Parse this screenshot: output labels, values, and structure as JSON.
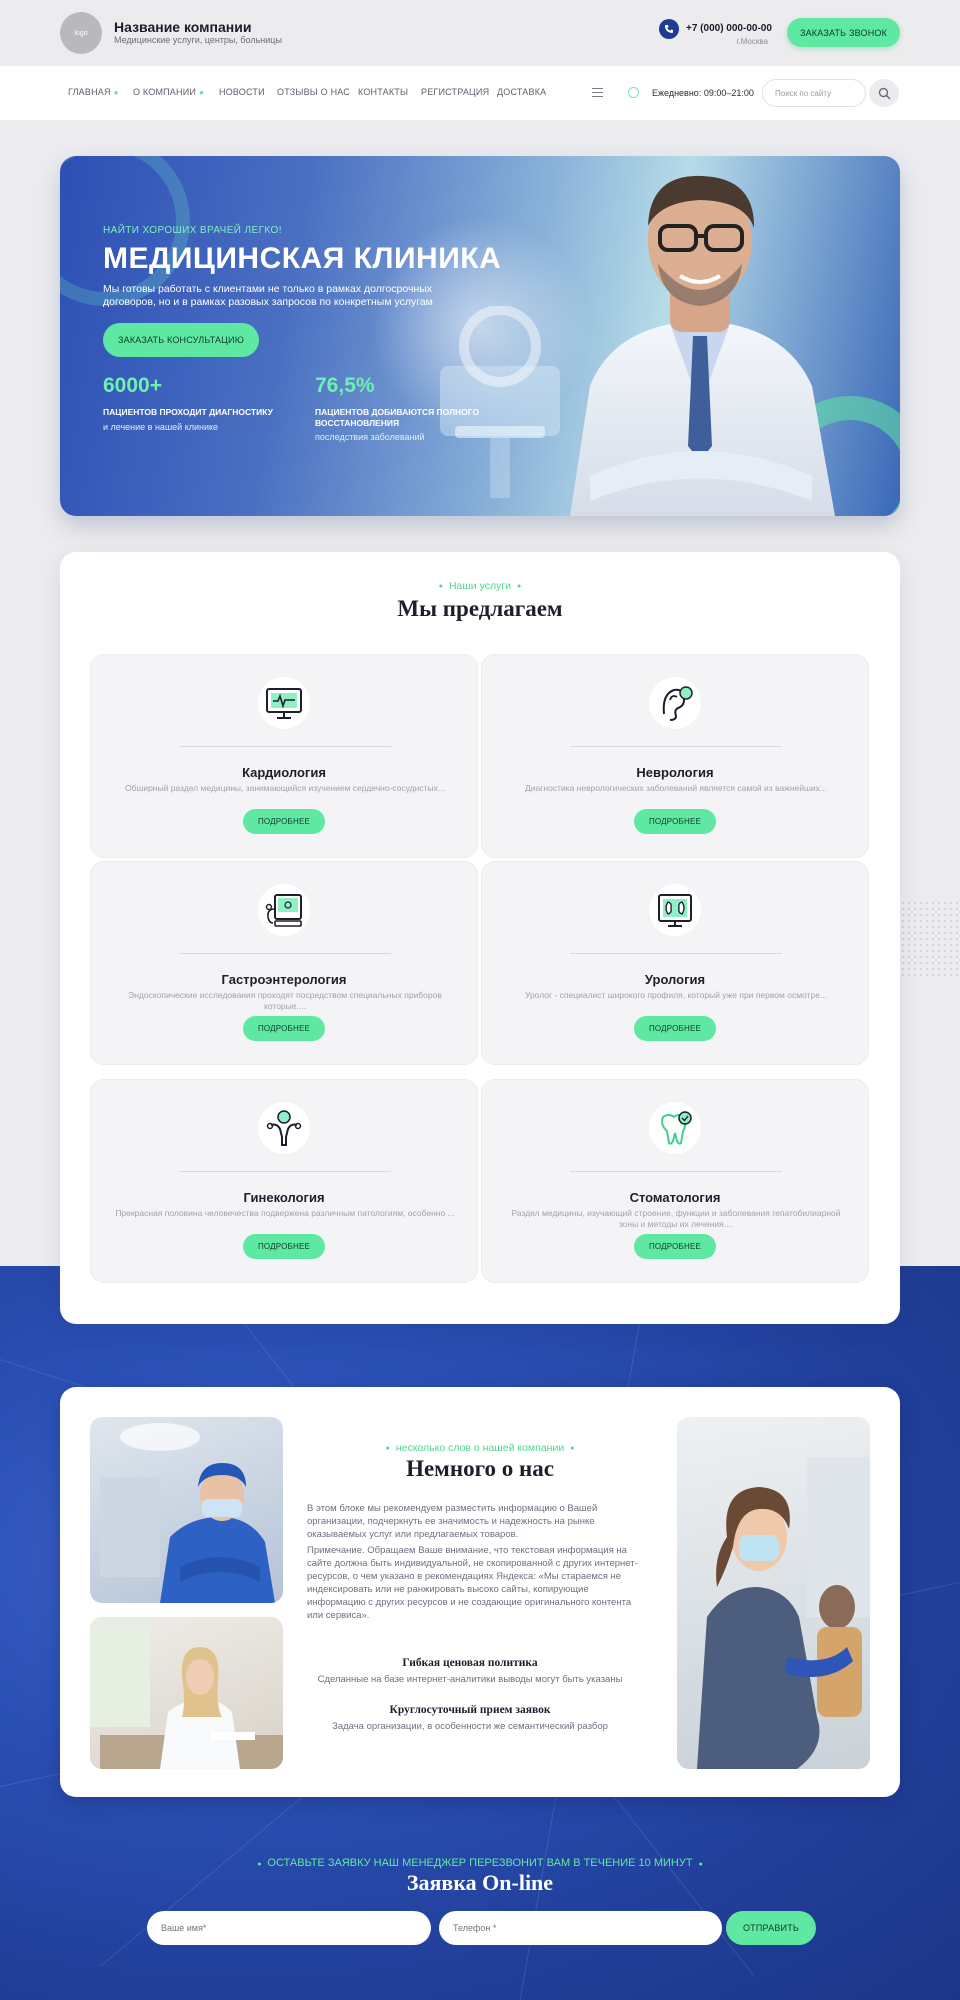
{
  "header": {
    "logo_text": "logo",
    "company_name": "Название компании",
    "company_sub": "Медицинские услуги, центры, больницы",
    "phone": "+7 (000) 000-00-00",
    "city": "г.Москва",
    "call_button": "Заказать звонок"
  },
  "nav": {
    "items": [
      {
        "label": "Главная"
      },
      {
        "label": "О компании"
      },
      {
        "label": "Новости"
      },
      {
        "label": "Отзывы о нас"
      },
      {
        "label": "Контакты"
      },
      {
        "label": "Регистрация"
      },
      {
        "label": "Доставка"
      }
    ],
    "hours": "Ежедневно: 09:00–21:00",
    "search_placeholder": "Поиск по сайту"
  },
  "hero": {
    "kicker": "Найти хороших врачей легко!",
    "title": "МЕДИЦИНСКАЯ КЛИНИКА",
    "lead": "Мы готовы работать с клиентами не только в рамках долгосрочных договоров, но и в рамках разовых запросов по конкретным услугам",
    "button": "Заказать консультацию",
    "stats": [
      {
        "number": "6000+",
        "label": "Пациентов проходит диагностику",
        "sub": "и лечение в нашей клинике"
      },
      {
        "number": "76,5%",
        "label": "Пациентов добиваются полного восстановления",
        "sub": "последствия заболеваний"
      }
    ]
  },
  "services": {
    "kicker": "Наши услуги",
    "title": "Мы предлагаем",
    "cards": [
      {
        "title": "Кардиология",
        "desc": "Обширный раздел медицины, занимающийся изучением сердечно-сосудистых...",
        "button": "Подробнее",
        "icon": "cardio-monitor-icon"
      },
      {
        "title": "Неврология",
        "desc": "Диагностика неврологических заболеваний является самой из важнейших...",
        "button": "Подробнее",
        "icon": "ear-nerve-icon"
      },
      {
        "title": "Гастроэнтерология",
        "desc": "Эндоскопические исследования проходят посредством специальных приборов которые....",
        "button": "Подробнее",
        "icon": "endoscope-device-icon"
      },
      {
        "title": "Урология",
        "desc": "Уролог - специалист широкого профиля, который уже при первом осмотре...",
        "button": "Подробнее",
        "icon": "kidney-screen-icon"
      },
      {
        "title": "Гинекология",
        "desc": "Прекрасная половина человечества подвержена различным патологиям, особенно ...",
        "button": "Подробнее",
        "icon": "uterus-icon"
      },
      {
        "title": "Стоматология",
        "desc": "Раздел медицины, изучающий строение, функции и заболевания гепатобилиарной зоны и методы их лечения....",
        "button": "Подробнее",
        "icon": "tooth-icon"
      }
    ]
  },
  "about": {
    "kicker": "несколько слов о нашей компании",
    "title": "Немного о нас",
    "p1": "В этом блоке мы рекомендуем разместить информацию о Вашей организации, подчеркнуть ее значимость и надежность на рынке оказываемых услуг или предлагаемых товаров.",
    "p2": "Примечание. Обращаем Ваше внимание, что текстовая информация на сайте должна быть индивидуальной, не скопированной с других интернет-ресурсов, о чем указано в рекомендациях Яндекса: «Мы стараемся не индексировать или не ранжировать высоко сайты, копирующие информацию с других ресурсов и не создающие оригинального контента или сервиса».",
    "features": [
      {
        "title": "Гибкая ценовая политика",
        "desc": "Сделанные на базе интернет-аналитики выводы могут быть указаны"
      },
      {
        "title": "Круглосуточный прием заявок",
        "desc": "Задача организации, в особенности же семантический разбор"
      }
    ]
  },
  "request": {
    "kicker": "Оставьте заявку наш менеджер перезвонит вам в течение 10 минут",
    "title": "Заявка On-line",
    "name_placeholder": "Ваше имя*",
    "phone_placeholder": "Телефон *",
    "submit": "Отправить"
  },
  "colors": {
    "accent_green": "#5fe8a2",
    "brand_blue": "#2a4fb4",
    "title_dark": "#1d1f2c"
  }
}
